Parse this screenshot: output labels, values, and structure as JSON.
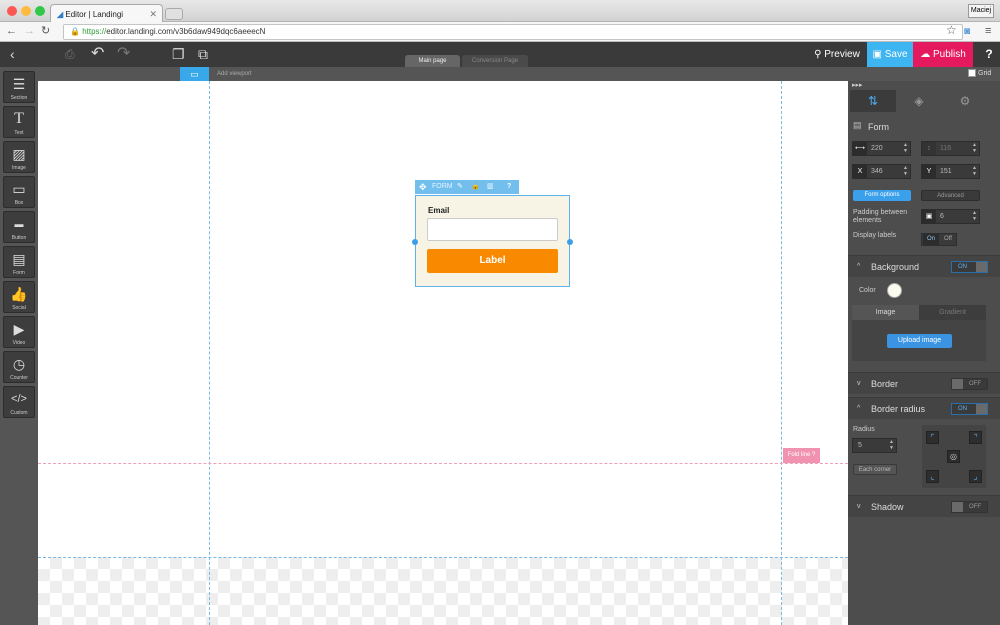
{
  "browser": {
    "tab_title": "Editor | Landingi",
    "url_secure": "https://",
    "url_rest": "editor.landingi.com/v3b6daw949dqc6aeeecN",
    "user_label": "Maciej"
  },
  "toolbar": {
    "preview_label": "Preview",
    "save_label": "Save",
    "publish_label": "Publish",
    "help_label": "?",
    "tabs": [
      "Main page",
      "Conversion Page"
    ],
    "add_viewport_label": "Add viewport"
  },
  "sidebar": {
    "items": [
      {
        "label": "Section",
        "icon": "menu-icon"
      },
      {
        "label": "Text",
        "icon": "text-icon"
      },
      {
        "label": "Image",
        "icon": "image-icon"
      },
      {
        "label": "Box",
        "icon": "box-icon"
      },
      {
        "label": "Button",
        "icon": "button-icon"
      },
      {
        "label": "Form",
        "icon": "form-icon"
      },
      {
        "label": "Social",
        "icon": "thumb-icon"
      },
      {
        "label": "Video",
        "icon": "video-icon"
      },
      {
        "label": "Counter",
        "icon": "clock-icon"
      },
      {
        "label": "Custom",
        "icon": "code-icon"
      }
    ]
  },
  "canvas": {
    "form_toolbar_label": "FORM",
    "form_toolbar_help": "?",
    "email_label": "Email",
    "submit_label": "Label",
    "fold_line_label": "Fold line ?",
    "grid_label": "Grid",
    "form_bg": "#f7f4e6",
    "submit_color": "#f98a00"
  },
  "panel": {
    "section_title": "Form",
    "width": "220",
    "height": "116",
    "x_prefix": "X",
    "x": "346",
    "y_prefix": "Y",
    "y": "151",
    "form_options_label": "Form options",
    "advanced_label": "Advanced",
    "padding_label": "Padding between elements",
    "padding_value": "6",
    "display_labels": "Display labels",
    "on_label": "On",
    "off_label": "Off",
    "background": {
      "title": "Background",
      "switch": "ON",
      "color_label": "Color",
      "image_tab": "Image",
      "gradient_tab": "Gradient",
      "upload_label": "Upload image"
    },
    "border": {
      "title": "Border",
      "switch": "OFF"
    },
    "border_radius": {
      "title": "Border radius",
      "switch": "ON",
      "radius_label": "Radius",
      "radius_value": "5",
      "each_corner_label": "Each corner"
    },
    "shadow": {
      "title": "Shadow",
      "switch": "OFF"
    }
  }
}
